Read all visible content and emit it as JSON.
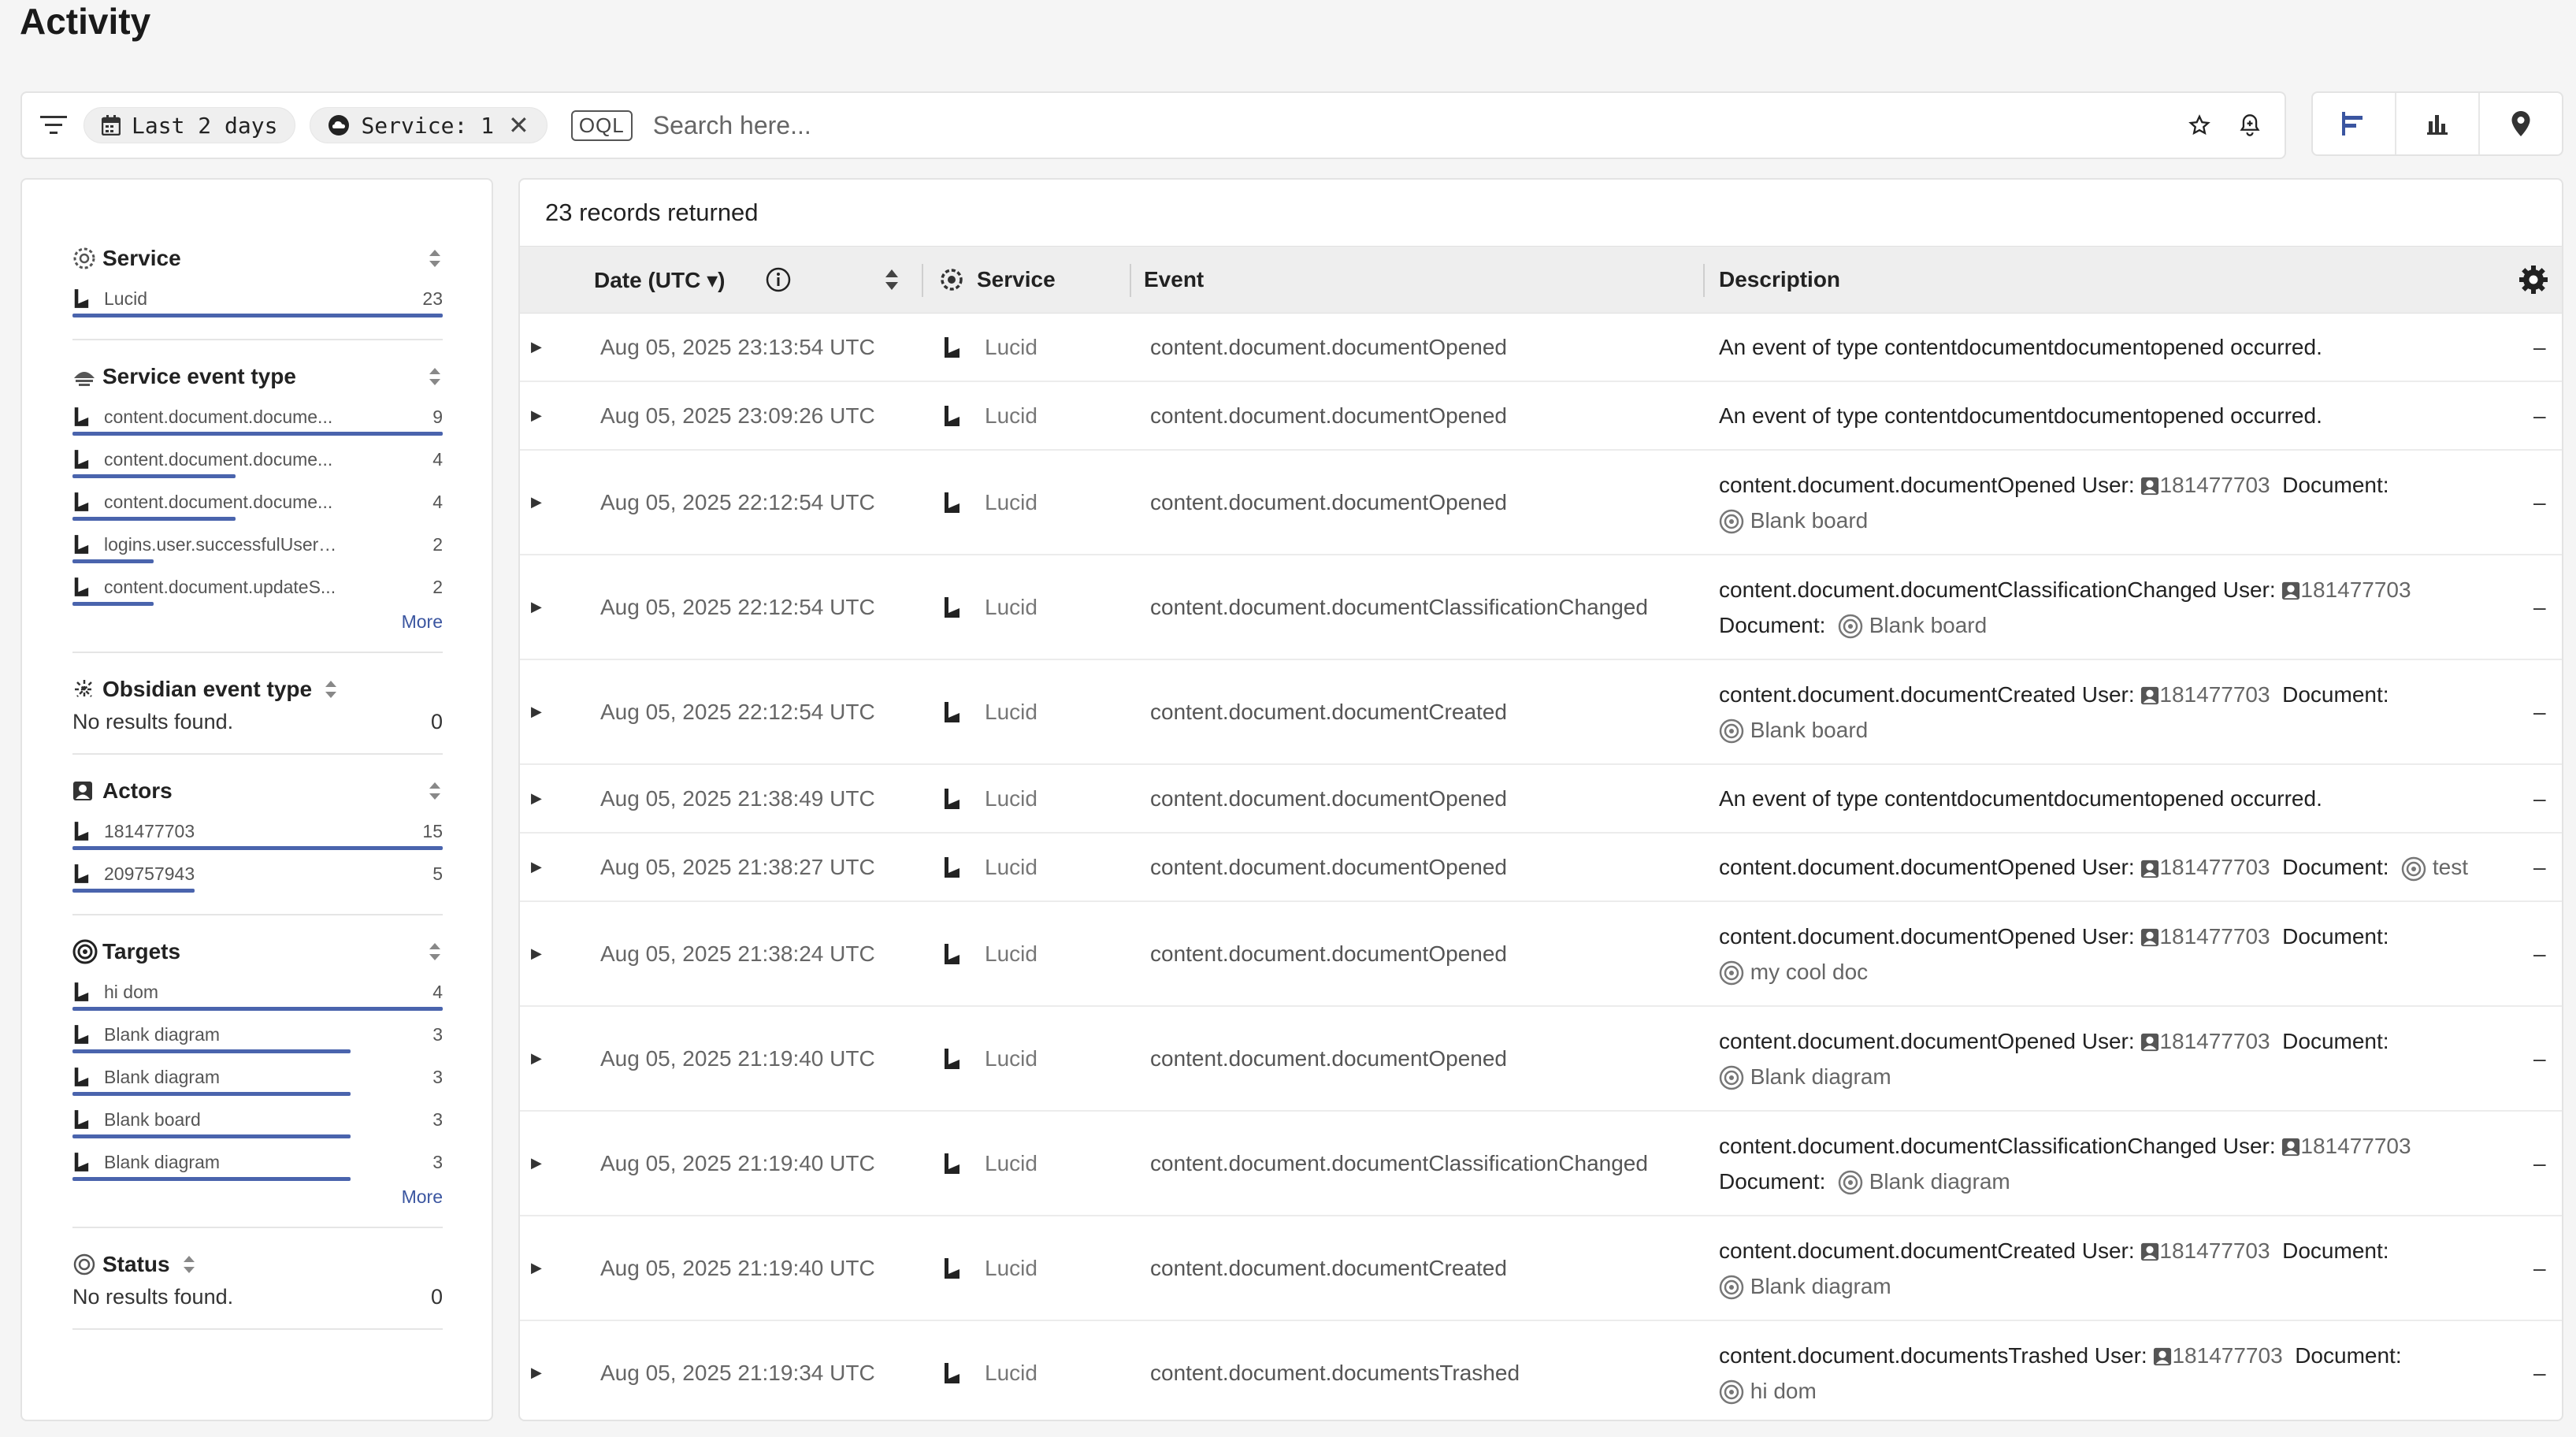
{
  "page": {
    "title": "Activity"
  },
  "toolbar": {
    "date_chip": "Last 2 days",
    "service_chip": "Service: 1",
    "oql_label": "OQL",
    "search_placeholder": "Search here..."
  },
  "sidebar": {
    "service": {
      "title": "Service",
      "items": [
        {
          "label": "Lucid",
          "count": "23",
          "fraction": 1.0
        }
      ]
    },
    "service_event_type": {
      "title": "Service event type",
      "items": [
        {
          "label": "content.document.docume...",
          "count": "9",
          "fraction": 1.0
        },
        {
          "label": "content.document.docume...",
          "count": "4",
          "fraction": 0.44
        },
        {
          "label": "content.document.docume...",
          "count": "4",
          "fraction": 0.44
        },
        {
          "label": "logins.user.successfulUserL...",
          "count": "2",
          "fraction": 0.22
        },
        {
          "label": "content.document.updateS...",
          "count": "2",
          "fraction": 0.22
        }
      ],
      "more": "More"
    },
    "obsidian_event_type": {
      "title": "Obsidian event type",
      "empty": "No results found.",
      "count": "0"
    },
    "actors": {
      "title": "Actors",
      "items": [
        {
          "label": "181477703",
          "count": "15",
          "fraction": 1.0
        },
        {
          "label": "209757943",
          "count": "5",
          "fraction": 0.33
        }
      ]
    },
    "targets": {
      "title": "Targets",
      "items": [
        {
          "label": "hi dom",
          "count": "4",
          "fraction": 1.0
        },
        {
          "label": "Blank diagram",
          "count": "3",
          "fraction": 0.75
        },
        {
          "label": "Blank diagram",
          "count": "3",
          "fraction": 0.75
        },
        {
          "label": "Blank board",
          "count": "3",
          "fraction": 0.75
        },
        {
          "label": "Blank diagram",
          "count": "3",
          "fraction": 0.75
        }
      ],
      "more": "More"
    },
    "status": {
      "title": "Status",
      "empty": "No results found.",
      "count": "0"
    }
  },
  "main": {
    "records_text": "23 records returned",
    "columns": {
      "date": "Date (UTC ▾)",
      "service": "Service",
      "event": "Event",
      "description": "Description"
    },
    "rows": [
      {
        "date": "Aug 05, 2025 23:13:54 UTC",
        "service": "Lucid",
        "event": "content.document.documentOpened",
        "desc_type": "plain",
        "desc": "An event of type contentdocumentdocumentopened occurred.",
        "extra": "–"
      },
      {
        "date": "Aug 05, 2025 23:09:26 UTC",
        "service": "Lucid",
        "event": "content.document.documentOpened",
        "desc_type": "plain",
        "desc": "An event of type contentdocumentdocumentopened occurred.",
        "extra": "–"
      },
      {
        "date": "Aug 05, 2025 22:12:54 UTC",
        "service": "Lucid",
        "event": "content.document.documentOpened",
        "desc_type": "rich",
        "desc_event": "content.document.documentOpened User:",
        "user": "181477703",
        "doc_label": "Document:",
        "doc": "Blank board",
        "extra": "–"
      },
      {
        "date": "Aug 05, 2025 22:12:54 UTC",
        "service": "Lucid",
        "event": "content.document.documentClassificationChanged",
        "desc_type": "rich",
        "desc_event": "content.document.documentClassificationChanged User:",
        "user": "181477703",
        "doc_label": "Document:",
        "doc": "Blank board",
        "extra": "–"
      },
      {
        "date": "Aug 05, 2025 22:12:54 UTC",
        "service": "Lucid",
        "event": "content.document.documentCreated",
        "desc_type": "rich",
        "desc_event": "content.document.documentCreated User:",
        "user": "181477703",
        "doc_label": "Document:",
        "doc": "Blank board",
        "extra": "–"
      },
      {
        "date": "Aug 05, 2025 21:38:49 UTC",
        "service": "Lucid",
        "event": "content.document.documentOpened",
        "desc_type": "plain",
        "desc": "An event of type contentdocumentdocumentopened occurred.",
        "extra": "–"
      },
      {
        "date": "Aug 05, 2025 21:38:27 UTC",
        "service": "Lucid",
        "event": "content.document.documentOpened",
        "desc_type": "rich",
        "desc_event": "content.document.documentOpened User:",
        "user": "181477703",
        "doc_label": "Document:",
        "doc": "test",
        "extra": "–"
      },
      {
        "date": "Aug 05, 2025 21:38:24 UTC",
        "service": "Lucid",
        "event": "content.document.documentOpened",
        "desc_type": "rich",
        "desc_event": "content.document.documentOpened User:",
        "user": "181477703",
        "doc_label": "Document:",
        "doc": "my cool doc",
        "extra": "–"
      },
      {
        "date": "Aug 05, 2025 21:19:40 UTC",
        "service": "Lucid",
        "event": "content.document.documentOpened",
        "desc_type": "rich",
        "desc_event": "content.document.documentOpened User:",
        "user": "181477703",
        "doc_label": "Document:",
        "doc": "Blank diagram",
        "extra": "–"
      },
      {
        "date": "Aug 05, 2025 21:19:40 UTC",
        "service": "Lucid",
        "event": "content.document.documentClassificationChanged",
        "desc_type": "rich",
        "desc_event": "content.document.documentClassificationChanged User:",
        "user": "181477703",
        "doc_label": "Document:",
        "doc": "Blank diagram",
        "extra": "–"
      },
      {
        "date": "Aug 05, 2025 21:19:40 UTC",
        "service": "Lucid",
        "event": "content.document.documentCreated",
        "desc_type": "rich",
        "desc_event": "content.document.documentCreated User:",
        "user": "181477703",
        "doc_label": "Document:",
        "doc": "Blank diagram",
        "extra": "–"
      },
      {
        "date": "Aug 05, 2025 21:19:34 UTC",
        "service": "Lucid",
        "event": "content.document.documentsTrashed",
        "desc_type": "rich",
        "desc_event": "content.document.documentsTrashed User:",
        "user": "181477703",
        "doc_label": "Document:",
        "doc": "hi dom",
        "extra": "–"
      }
    ]
  },
  "colors": {
    "accent": "#4a64ad",
    "header_bg": "#eeeeee"
  }
}
